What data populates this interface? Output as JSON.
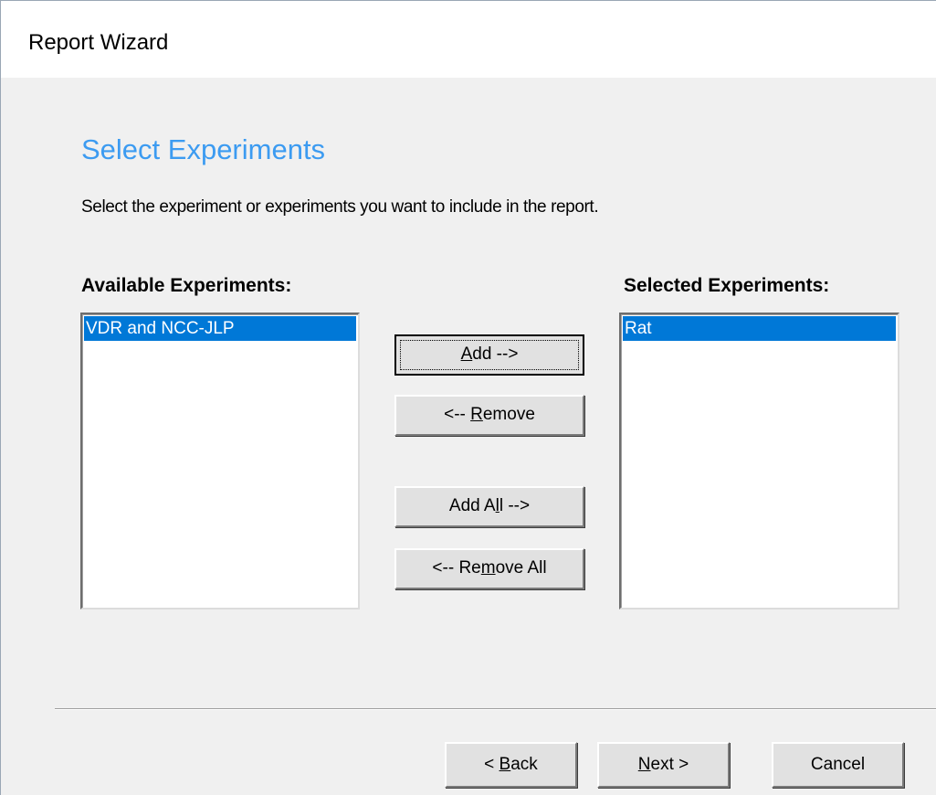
{
  "window": {
    "title": "Report Wizard"
  },
  "page": {
    "heading": "Select Experiments",
    "instruction": "Select the experiment or experiments you want to include in the report."
  },
  "available": {
    "label": "Available Experiments:",
    "items": [
      {
        "label": "VDR and NCC-JLP",
        "selected": true
      }
    ]
  },
  "selected": {
    "label": "Selected Experiments:",
    "items": [
      {
        "label": "Rat",
        "selected": true
      }
    ]
  },
  "buttons": {
    "add": {
      "label": "Add -->",
      "mnemonic": "A",
      "default": true
    },
    "remove": {
      "label": "<-- Remove",
      "mnemonic": "R"
    },
    "add_all": {
      "label": "Add All -->",
      "mnemonic": "l"
    },
    "remove_all": {
      "label": "<-- Remove All",
      "mnemonic": "m"
    }
  },
  "nav": {
    "back": {
      "label": "< Back",
      "mnemonic": "B"
    },
    "next": {
      "label": "Next >",
      "mnemonic": "N"
    },
    "cancel": {
      "label": "Cancel"
    }
  },
  "colors": {
    "heading": "#3c9bf1",
    "selection": "#0078d7",
    "dialog_bg": "#f0f0f0"
  }
}
